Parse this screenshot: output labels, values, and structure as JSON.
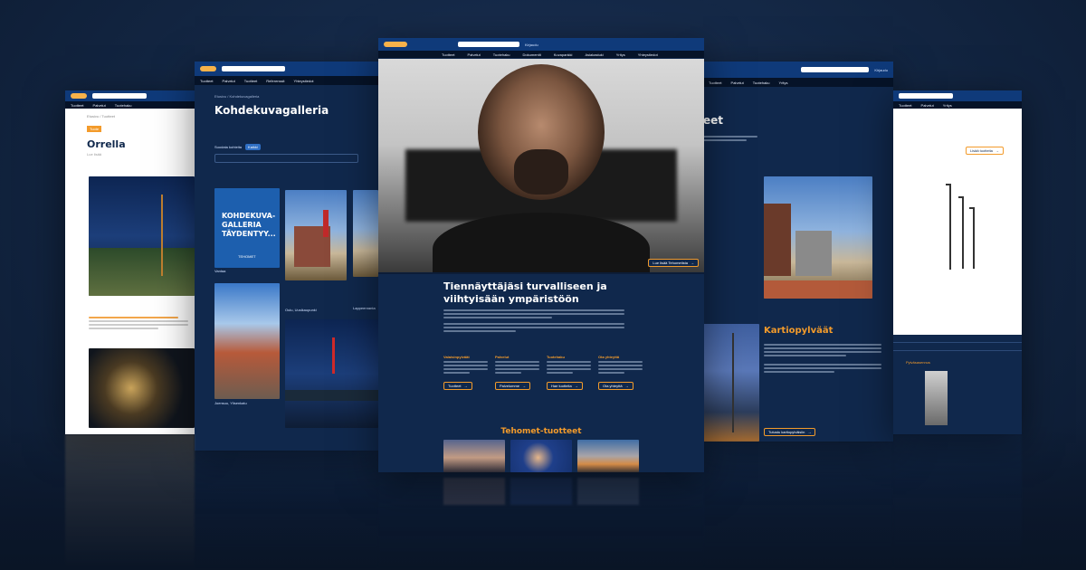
{
  "left_outer": {
    "breadcrumb": "Etusivu / Tuotteet",
    "tag": "Tuote",
    "title": "Orrella",
    "subtitle": "Lue lisää"
  },
  "left_mid": {
    "nav": [
      "Tuotteet",
      "Palvelut",
      "Tuotteet",
      "Referenssit",
      "Yhteystiedot"
    ],
    "breadcrumb": "Etusivu / Kohdekuvagalleria",
    "title": "Kohdekuvagalleria",
    "filter_label": "Suodata kohteita",
    "filter_badge": "Kaikki",
    "card_lines": [
      "KOHDEKUVA-",
      "GALLERIA",
      "TÄYDENTYY..."
    ],
    "card_logo": "TEHOMET",
    "caption1": "Vantaa",
    "caption2": "Oulu, Uusikaupunki",
    "caption3": "Lappeenranta",
    "caption4": "Joensuu, Ylisenkatu"
  },
  "center": {
    "nav": [
      "Tuotteet",
      "Palvelut",
      "Tuotehaku",
      "Dokumentit",
      "Kuvapankki",
      "Asiakastuki",
      "Yritys",
      "Yhteystiedot"
    ],
    "hero_button": "Lue lisää Tehometista",
    "headline_line1": "Tiennäyttäjäsi turvalliseen ja",
    "headline_line2": "viihtyisään ympäristöön",
    "columns": [
      {
        "title": "Valaisinpylväät",
        "button": "Tuotteet"
      },
      {
        "title": "Palvelut",
        "button": "Palvelumme"
      },
      {
        "title": "Tuotehaku",
        "button": "Hae tuotteita"
      },
      {
        "title": "Ota yhteyttä",
        "button": "Ota yhteyttä"
      }
    ],
    "products_title": "Tehomet-tuotteet"
  },
  "right_mid": {
    "title_fragment": "eet",
    "section_title": "Kartiopylväät",
    "button": "Tutustu kartiopylväisiin"
  },
  "right_outer": {
    "button": "Lisää tuotteita",
    "section": "Pylväsasennus"
  },
  "colors": {
    "navy": "#10284c",
    "header_blue": "#0f3a7a",
    "accent_orange": "#f39b2b",
    "background": "#142846"
  }
}
